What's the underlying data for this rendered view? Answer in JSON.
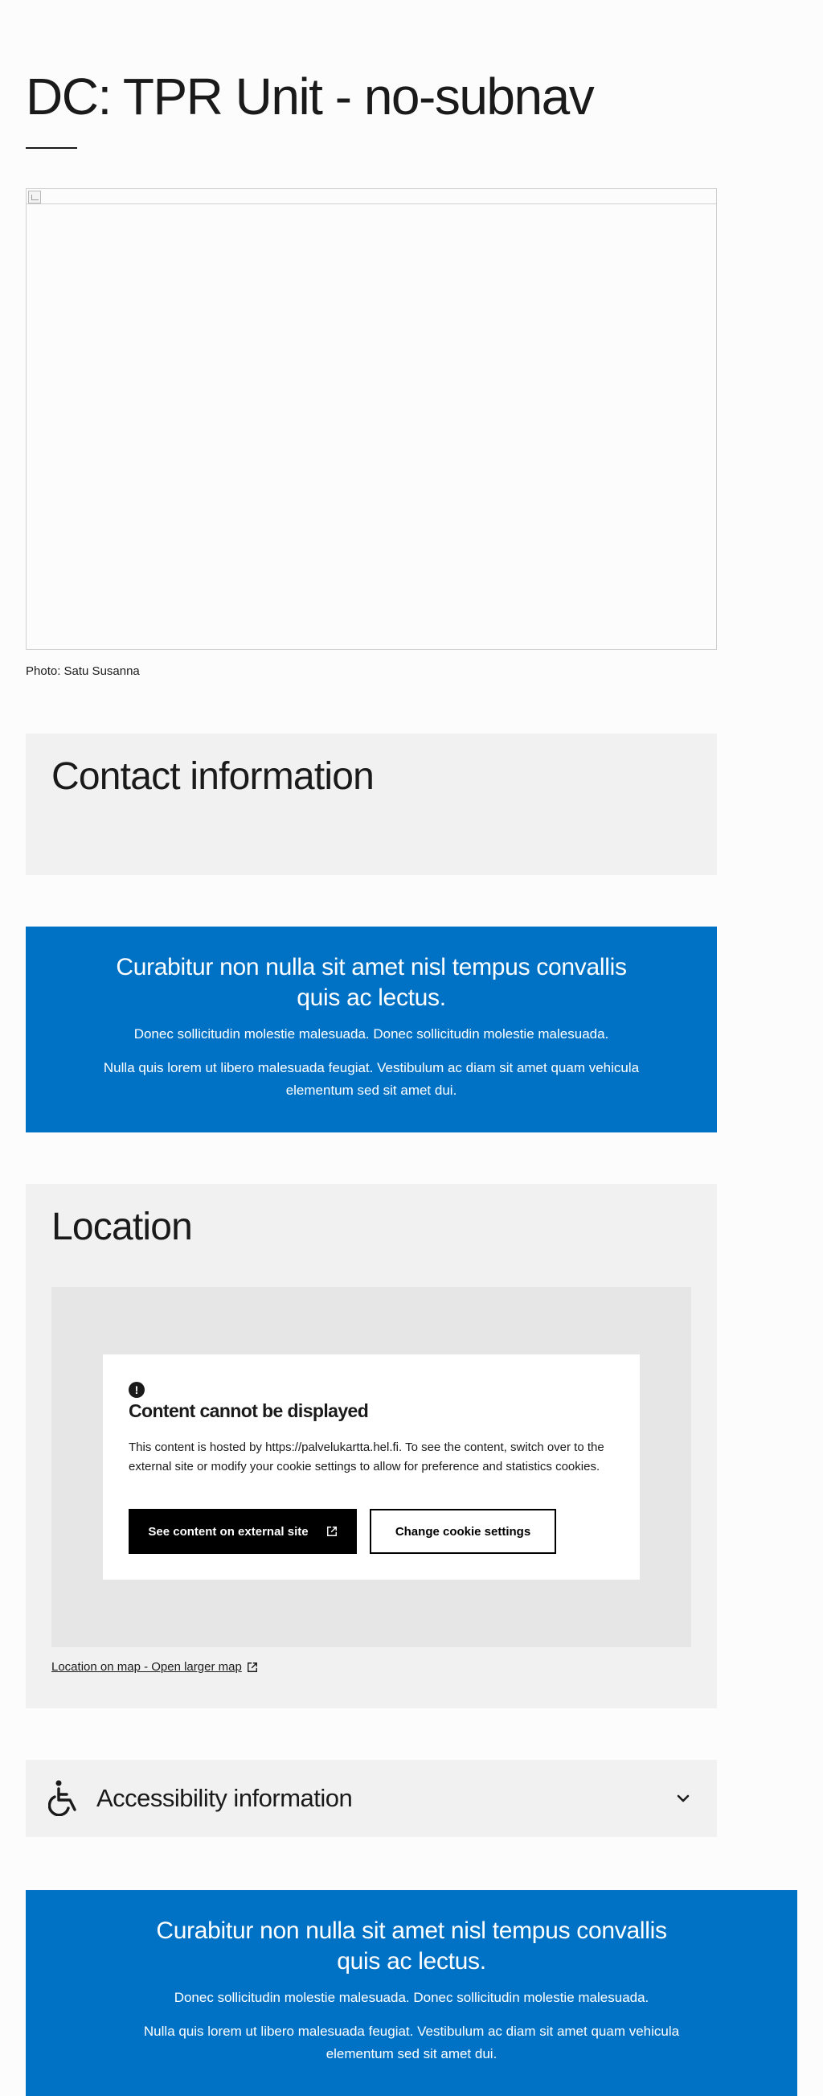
{
  "page": {
    "title": "DC: TPR Unit - no-subnav"
  },
  "hero": {
    "caption": "Photo: Satu Susanna"
  },
  "contact": {
    "heading": "Contact information"
  },
  "banner_top": {
    "title": "Curabitur non nulla sit amet nisl tempus convallis quis ac lectus.",
    "line1": "Donec sollicitudin molestie malesuada. Donec sollicitudin molestie malesuada.",
    "line2": "Nulla quis lorem ut libero malesuada feugiat. Vestibulum ac diam sit amet quam vehicula elementum sed sit amet dui."
  },
  "location": {
    "heading": "Location",
    "notice": {
      "icon": "alert-circle-icon",
      "title": "Content cannot be displayed",
      "text": "This content is hosted by https://palvelukartta.hel.fi. To see the content, switch over to the external site or modify your cookie settings to allow for preference and statistics cookies.",
      "primary_button": "See content on external site",
      "secondary_button": "Change cookie settings"
    },
    "map_link": "Location on map - Open larger map"
  },
  "accessibility": {
    "label": "Accessibility information",
    "icon": "wheelchair-icon",
    "toggle_icon": "chevron-down-icon"
  },
  "banner_bottom": {
    "title": "Curabitur non nulla sit amet nisl tempus convallis quis ac lectus.",
    "line1": "Donec sollicitudin molestie malesuada. Donec sollicitudin molestie malesuada.",
    "line2": "Nulla quis lorem ut libero malesuada feugiat. Vestibulum ac diam sit amet quam vehicula elementum sed sit amet dui."
  },
  "colors": {
    "banner_blue": "#0072c6",
    "section_grey": "#f1f1f1",
    "map_grey": "#e6e6e6"
  }
}
